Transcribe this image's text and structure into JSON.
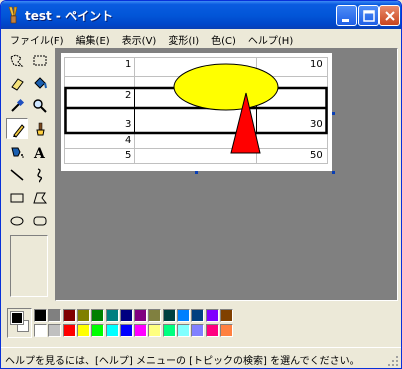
{
  "window": {
    "title": "test - ペイント",
    "icon": "paint-brush-icon"
  },
  "title_buttons": [
    "minimize-icon",
    "maximize-icon",
    "close-icon"
  ],
  "menu": [
    {
      "label": "ファイル(F)"
    },
    {
      "label": "編集(E)"
    },
    {
      "label": "表示(V)"
    },
    {
      "label": "変形(I)"
    },
    {
      "label": "色(C)"
    },
    {
      "label": "ヘルプ(H)"
    }
  ],
  "tools": [
    "free-form-select-icon",
    "rect-select-icon",
    "eraser-icon",
    "fill-bucket-icon",
    "color-picker-icon",
    "magnifier-icon",
    "pencil-icon",
    "brush-icon",
    "airbrush-icon",
    "text-icon",
    "line-icon",
    "curve-icon",
    "rectangle-icon",
    "polygon-icon",
    "ellipse-icon",
    "rounded-rect-icon"
  ],
  "selected_tool": "pencil-icon",
  "canvas": {
    "rows": [
      {
        "left": "1",
        "right": "10"
      },
      {
        "left": "2",
        "right": ""
      },
      {
        "left": "3",
        "right": "30"
      },
      {
        "left": "4",
        "right": ""
      },
      {
        "left": "5",
        "right": "50"
      }
    ],
    "shape_colors": {
      "ellipse": "#ffff00",
      "triangle": "#ff0000"
    }
  },
  "palette": {
    "foreground": "#000000",
    "background": "#ffffff",
    "row1": [
      "#000000",
      "#808080",
      "#800000",
      "#808000",
      "#008000",
      "#008080",
      "#000080",
      "#800080",
      "#808040",
      "#004040",
      "#0080ff",
      "#004080",
      "#8000ff",
      "#804000"
    ],
    "row2": [
      "#ffffff",
      "#c0c0c0",
      "#ff0000",
      "#ffff00",
      "#00ff00",
      "#00ffff",
      "#0000ff",
      "#ff00ff",
      "#ffff80",
      "#00ff80",
      "#80ffff",
      "#8080ff",
      "#ff0080",
      "#ff8040"
    ]
  },
  "status": {
    "text": "ヘルプを見るには、[ヘルプ] メニューの [トピックの検索] を選んでください。"
  }
}
